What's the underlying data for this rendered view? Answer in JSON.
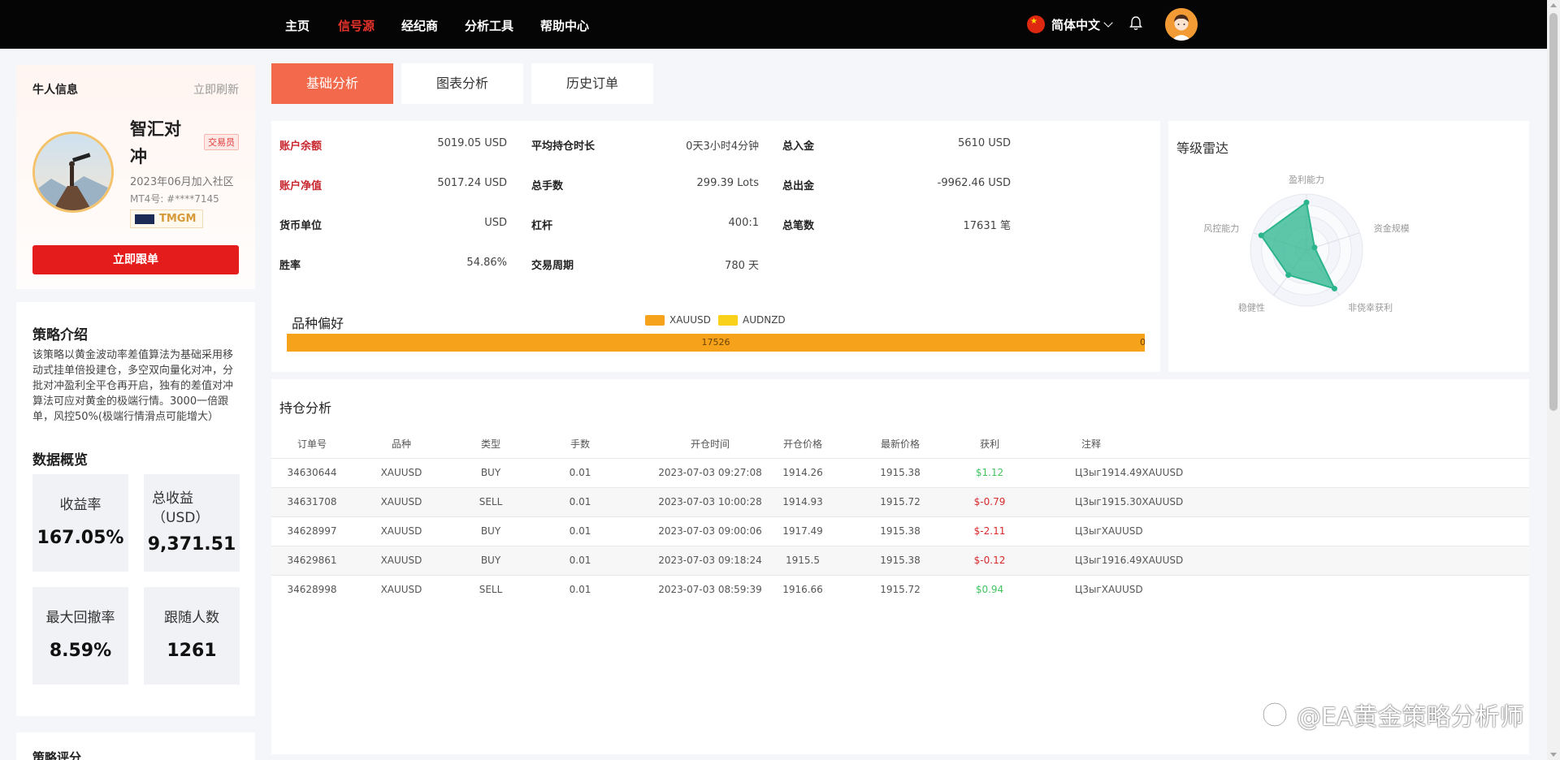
{
  "nav": {
    "items": [
      "主页",
      "信号源",
      "经纪商",
      "分析工具",
      "帮助中心"
    ],
    "active_index": 1,
    "language": "简体中文"
  },
  "profile": {
    "section_title": "牛人信息",
    "refresh_label": "立即刷新",
    "name": "智汇对冲",
    "badge": "交易员",
    "joined": "2023年06月加入社区",
    "mt4": "MT4号: #****7145",
    "broker": "TMGM",
    "follow_button": "立即跟单"
  },
  "strategy": {
    "title": "策略介绍",
    "description": "该策略以黄金波动率差值算法为基础采用移动式挂单倍投建仓，多空双向量化对冲，分批对冲盈利全平仓再开启，独有的差值对冲算法可应对黄金的极端行情。3000一倍跟单，风控50%(极端行情滑点可能增大）",
    "overview_title": "数据概览",
    "stats": [
      {
        "label": "收益率",
        "value": "167.05%"
      },
      {
        "label": "总收益（USD）",
        "value": "9,371.51"
      },
      {
        "label": "最大回撤率",
        "value": "8.59%"
      },
      {
        "label": "跟随人数",
        "value": "1261"
      }
    ]
  },
  "rating": {
    "title": "策略评分"
  },
  "tabs": [
    "基础分析",
    "图表分析",
    "历史订单"
  ],
  "active_tab": 0,
  "account": {
    "col1": [
      {
        "label": "账户余额",
        "value": "5019.05 USD",
        "highlight": true
      },
      {
        "label": "账户净值",
        "value": "5017.24 USD",
        "highlight": true
      },
      {
        "label": "货币单位",
        "value": "USD",
        "highlight": false
      },
      {
        "label": "胜率",
        "value": "54.86%",
        "highlight": false
      }
    ],
    "col2": [
      {
        "label": "平均持仓时长",
        "value": "0天3小时4分钟"
      },
      {
        "label": "总手数",
        "value": "299.39 Lots"
      },
      {
        "label": "杠杆",
        "value": "400:1"
      },
      {
        "label": "交易周期",
        "value": "780 天"
      }
    ],
    "col3": [
      {
        "label": "总入金",
        "value": "5610 USD"
      },
      {
        "label": "总出金",
        "value": "-9962.46 USD"
      },
      {
        "label": "总笔数",
        "value": "17631 笔"
      }
    ]
  },
  "preference": {
    "title": "品种偏好",
    "legend": [
      {
        "name": "XAUUSD",
        "color": "#f7a21b"
      },
      {
        "name": "AUDNZD",
        "color": "#f9d11b"
      }
    ],
    "values": [
      17526,
      0
    ],
    "value_labels": [
      "17526",
      "0"
    ]
  },
  "radar": {
    "title": "等级雷达",
    "axes": [
      "盈利能力",
      "资金规模",
      "非侥幸获利",
      "稳健性",
      "风控能力"
    ],
    "values": [
      0.85,
      0.15,
      0.85,
      0.55,
      0.85
    ],
    "color": "#2bb58c"
  },
  "positions": {
    "title": "持仓分析",
    "headers": [
      "订单号",
      "品种",
      "类型",
      "手数",
      "开仓时间",
      "开仓价格",
      "最新价格",
      "获利",
      "注释"
    ],
    "rows": [
      {
        "order": "34630644",
        "symbol": "XAUUSD",
        "type": "BUY",
        "lots": "0.01",
        "open_time": "2023-07-03 09:27:08",
        "open_price": "1914.26",
        "last_price": "1915.38",
        "profit": "$1.12",
        "profit_sign": "pos",
        "comment": "Ц3ыг1914.49XAUUSD"
      },
      {
        "order": "34631708",
        "symbol": "XAUUSD",
        "type": "SELL",
        "lots": "0.01",
        "open_time": "2023-07-03 10:00:28",
        "open_price": "1914.93",
        "last_price": "1915.72",
        "profit": "$-0.79",
        "profit_sign": "neg",
        "comment": "Ц3ыг1915.30XAUUSD"
      },
      {
        "order": "34628997",
        "symbol": "XAUUSD",
        "type": "BUY",
        "lots": "0.01",
        "open_time": "2023-07-03 09:00:06",
        "open_price": "1917.49",
        "last_price": "1915.38",
        "profit": "$-2.11",
        "profit_sign": "neg",
        "comment": "Ц3ыгXAUUSD"
      },
      {
        "order": "34629861",
        "symbol": "XAUUSD",
        "type": "BUY",
        "lots": "0.01",
        "open_time": "2023-07-03 09:18:24",
        "open_price": "1915.5",
        "last_price": "1915.38",
        "profit": "$-0.12",
        "profit_sign": "neg",
        "comment": "Ц3ыг1916.49XAUUSD"
      },
      {
        "order": "34628998",
        "symbol": "XAUUSD",
        "type": "SELL",
        "lots": "0.01",
        "open_time": "2023-07-03 08:59:39",
        "open_price": "1916.66",
        "last_price": "1915.72",
        "profit": "$0.94",
        "profit_sign": "pos",
        "comment": "Ц3ыгXAUUSD"
      }
    ]
  },
  "watermark": "@EA黄金策略分析师",
  "colors": {
    "accent_red": "#e51c1c",
    "tab_active": "#f26a4b",
    "profit_green": "#45c45f",
    "loss_red": "#d92a2a"
  }
}
